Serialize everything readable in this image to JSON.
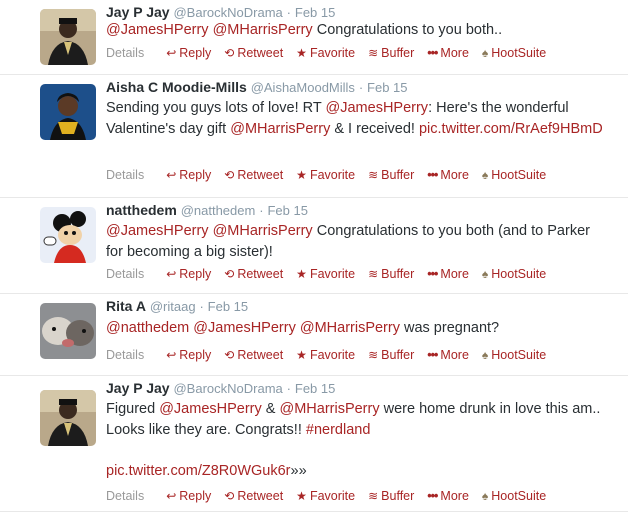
{
  "tweets": [
    {
      "name": "Jay P Jay",
      "handle": "@BarockNoDrama",
      "date": "Feb 15",
      "body": [
        {
          "t": "@JamesHPerry",
          "c": "mention"
        },
        {
          "t": " "
        },
        {
          "t": "@MHarrisPerry",
          "c": "mention"
        },
        {
          "t": " Congratulations to you both.."
        }
      ]
    },
    {
      "name": "Aisha C Moodie-Mills",
      "handle": "@AishaMoodMills",
      "date": "Feb 15",
      "body": [
        {
          "t": "Sending you guys lots of love! RT "
        },
        {
          "t": "@JamesHPerry",
          "c": "mention"
        },
        {
          "t": ": Here's the wonderful Valentine's day gift "
        },
        {
          "t": "@MHarrisPerry",
          "c": "mention"
        },
        {
          "t": " & I received! "
        },
        {
          "t": "pic.twitter.com/RrAef9HBmD",
          "c": "link"
        }
      ]
    },
    {
      "name": "natthedem",
      "handle": "@natthedem",
      "date": "Feb 15",
      "body": [
        {
          "t": "@JamesHPerry",
          "c": "mention"
        },
        {
          "t": " "
        },
        {
          "t": "@MHarrisPerry",
          "c": "mention"
        },
        {
          "t": " Congratulations to you both (and to Parker for becoming a big sister)!"
        }
      ]
    },
    {
      "name": "Rita A",
      "handle": "@ritaag",
      "date": "Feb 15",
      "body": [
        {
          "t": "@natthedem",
          "c": "mention"
        },
        {
          "t": " "
        },
        {
          "t": "@JamesHPerry",
          "c": "mention"
        },
        {
          "t": " "
        },
        {
          "t": "@MHarrisPerry",
          "c": "mention"
        },
        {
          "t": " was pregnant?"
        }
      ]
    },
    {
      "name": "Jay P Jay",
      "handle": "@BarockNoDrama",
      "date": "Feb 15",
      "body": [
        {
          "t": "Figured "
        },
        {
          "t": "@JamesHPerry",
          "c": "mention"
        },
        {
          "t": " & "
        },
        {
          "t": "@MHarrisPerry",
          "c": "mention"
        },
        {
          "t": " were home drunk in love this am.. Looks like they are. Congrats!! "
        },
        {
          "t": "#nerdland",
          "c": "mention"
        },
        {
          "br": true
        },
        {
          "br": true
        },
        {
          "t": "pic.twitter.com/Z8R0WGuk6r",
          "c": "link"
        },
        {
          "t": "»»"
        }
      ]
    }
  ],
  "actions": {
    "details": "Details",
    "reply": "Reply",
    "retweet": "Retweet",
    "favorite": "Favorite",
    "buffer": "Buffer",
    "more": "More",
    "hootsuite": "HootSuite"
  },
  "separator": "·",
  "colors": {
    "accent": "#a82525",
    "muted": "#8899a6"
  }
}
